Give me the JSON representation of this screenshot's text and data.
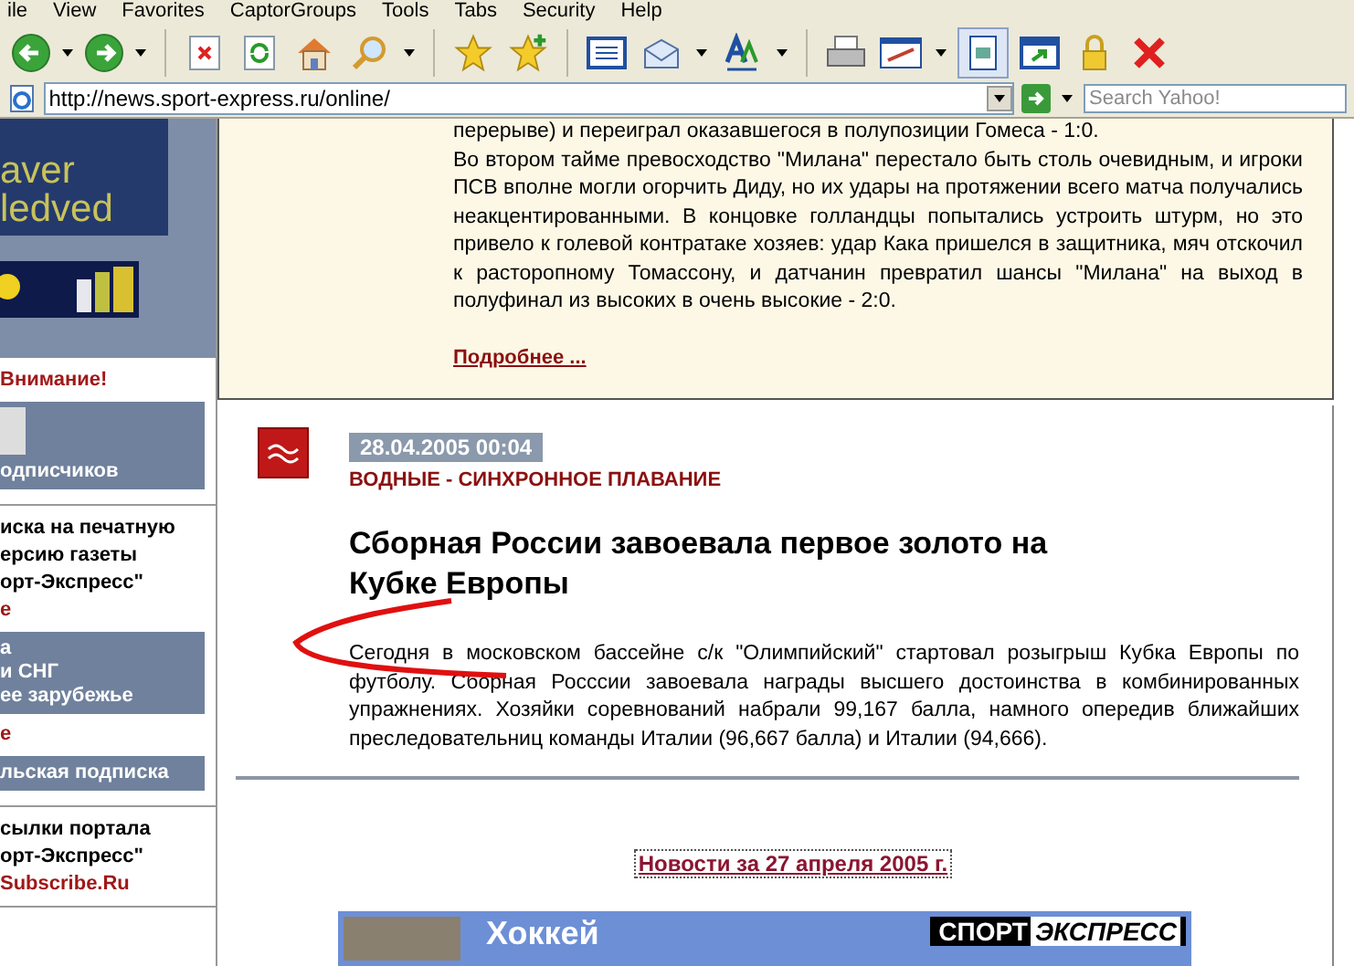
{
  "menu_bar": [
    "ile",
    "View",
    "Favorites",
    "CaptorGroups",
    "Tools",
    "Tabs",
    "Security",
    "Help"
  ],
  "address_bar": {
    "url": "http://news.sport-express.ru/online/",
    "search_placeholder": "Search Yahoo!"
  },
  "sidebar": {
    "ad_lines": [
      "aver",
      "ledved"
    ],
    "sections": [
      {
        "items": [
          {
            "kind": "alert",
            "text": "Внимание!"
          },
          {
            "kind": "box",
            "lines": [
              "одписчиков"
            ]
          }
        ]
      },
      {
        "items": [
          {
            "kind": "text",
            "text": "иска на печатную"
          },
          {
            "kind": "text",
            "text": "ерсию газеты"
          },
          {
            "kind": "text",
            "text": "орт-Экспресс\""
          },
          {
            "kind": "alert",
            "text": "е"
          },
          {
            "kind": "box",
            "lines": [
              "а",
              "и СНГ",
              "ее зарубежье"
            ]
          },
          {
            "kind": "alert",
            "text": "е"
          },
          {
            "kind": "box",
            "lines": [
              "льская подписка"
            ]
          }
        ]
      },
      {
        "items": [
          {
            "kind": "text",
            "text": "сылки портала"
          },
          {
            "kind": "text",
            "text": "орт-Экспресс\""
          },
          {
            "kind": "alert",
            "text": "Subscribe.Ru"
          }
        ]
      }
    ]
  },
  "previous_story": {
    "cut_line": "перерыве) и переиграл оказавшегося в полупозиции Гомеса - 1:0.",
    "paragraph": "Во втором тайме превосходство \"Милана\" перестало быть столь очевидным, и игроки ПСВ вполне могли огорчить Диду, но их удары на протяжении всего матча получались неакцентированными. В концовке голландцы попытались устроить штурм, но это привело к голевой контратаке хозяев: удар Кака пришелся в защитника, мяч отскочил к расторопному Томассону, и датчанин превратил шансы \"Милана\" на выход в полуфинал из высоких в очень высокие - 2:0.",
    "more_link": "Подробнее ..."
  },
  "article": {
    "date": "28.04.2005 00:04",
    "category": "ВОДНЫЕ - СИНХРОННОЕ ПЛАВАНИЕ",
    "title": "Сборная России завоевала первое золото на Кубке Европы",
    "body": "Сегодня в московском бассейне с/к \"Олимпийский\" стартовал розыгрыш Кубка Европы по футболу. Сборная Росссии завоевала награды высшего достоинства в комбинированных упражнениях. Хозяйки соревнований набрали 99,167 балла, намного опередив ближайших преследовательниц команды Италии (96,667 балла) и Италии (94,666)."
  },
  "news_link": "Новости за 27 апреля 2005 г.",
  "banner": {
    "title": "Хоккей",
    "logo": [
      "СПОРТ",
      "ЭКСПРЕСС"
    ]
  }
}
